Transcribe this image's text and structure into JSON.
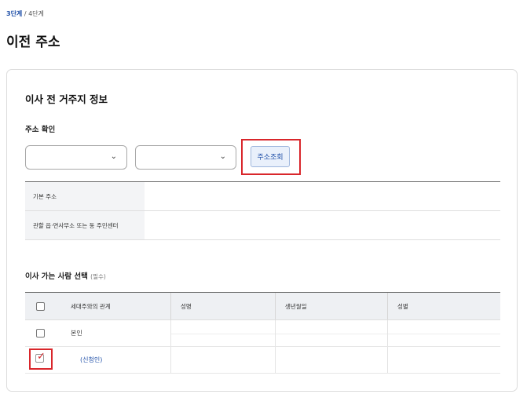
{
  "breadcrumb": {
    "current": "3단계",
    "separator": " / ",
    "next": "4단계"
  },
  "page_title": "이전 주소",
  "section": {
    "title": "이사 전 거주지 정보",
    "address_confirm_label": "주소 확인",
    "select1_value": "",
    "select2_value": "",
    "lookup_button": "주소조회",
    "chevron_icon": "chevron-down-icon",
    "info_rows": [
      {
        "label": "기본 주소",
        "value": ""
      },
      {
        "label": "관할 읍·면사무소 또는 동 주민센터",
        "value": ""
      }
    ]
  },
  "movers": {
    "title": "이사 가는 사람 선택",
    "required": "(필수)",
    "columns": [
      "세대주와의 관계",
      "성명",
      "생년월일",
      "성별"
    ],
    "rows": [
      {
        "relation": "본인",
        "name": "",
        "birth": "",
        "gender": "",
        "checked": false
      },
      {
        "relation": "(신청인)",
        "name": "",
        "birth": "",
        "gender": "",
        "checked": true
      }
    ]
  },
  "colors": {
    "accent": "#1f4fa8",
    "highlight": "#d9262b",
    "header_bg": "#eef0f3"
  }
}
